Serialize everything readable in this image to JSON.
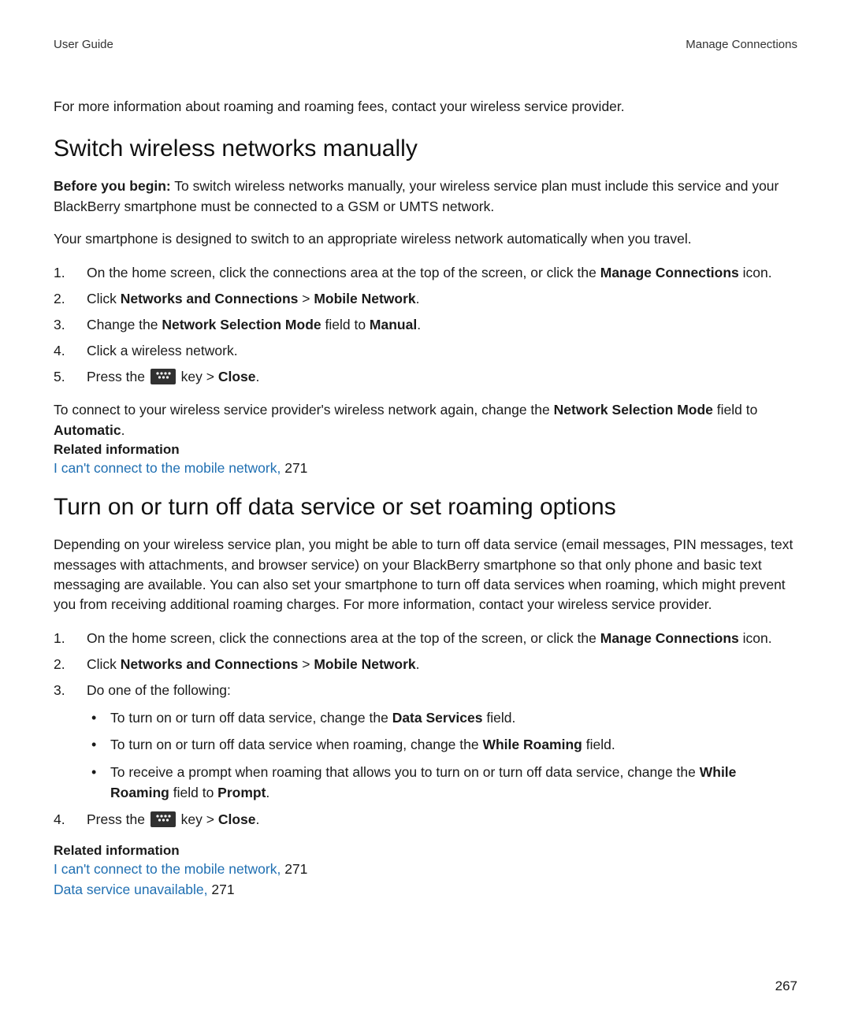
{
  "header": {
    "left": "User Guide",
    "right": "Manage Connections"
  },
  "intro": "For more information about roaming and roaming fees, contact your wireless service provider.",
  "section1": {
    "title": "Switch wireless networks manually",
    "before_label": "Before you begin:",
    "before_text": " To switch wireless networks manually, your wireless service plan must include this service and your BlackBerry smartphone must be connected to a GSM or UMTS network.",
    "para": "Your smartphone is designed to switch to an appropriate wireless network automatically when you travel.",
    "step1_a": "On the home screen, click the connections area at the top of the screen, or click the ",
    "step1_b": "Manage Connections",
    "step1_c": " icon.",
    "step2_a": "Click ",
    "step2_b": "Networks and Connections",
    "step2_c": " > ",
    "step2_d": "Mobile Network",
    "step2_e": ".",
    "step3_a": "Change the ",
    "step3_b": "Network Selection Mode",
    "step3_c": " field to ",
    "step3_d": "Manual",
    "step3_e": ".",
    "step4": "Click a wireless network.",
    "step5_a": "Press the ",
    "step5_b": " key > ",
    "step5_c": "Close",
    "step5_d": ".",
    "after_a": "To connect to your wireless service provider's wireless network again, change the ",
    "after_b": "Network Selection Mode",
    "after_c": " field to ",
    "after_d": "Automatic",
    "after_e": ".",
    "related_heading": "Related information",
    "link1_text": "I can't connect to the mobile network,",
    "link1_page": " 271"
  },
  "section2": {
    "title": "Turn on or turn off data service or set roaming options",
    "para": "Depending on your wireless service plan, you might be able to turn off data service (email messages, PIN messages, text messages with attachments, and browser service) on your BlackBerry smartphone so that only phone and basic text messaging are available. You can also set your smartphone to turn off data services when roaming, which might prevent you from receiving additional roaming charges. For more information, contact your wireless service provider.",
    "step1_a": "On the home screen, click the connections area at the top of the screen, or click the ",
    "step1_b": "Manage Connections",
    "step1_c": " icon.",
    "step2_a": "Click ",
    "step2_b": "Networks and Connections",
    "step2_c": " > ",
    "step2_d": "Mobile Network",
    "step2_e": ".",
    "step3": "Do one of the following:",
    "sub1_a": "To turn on or turn off data service, change the ",
    "sub1_b": "Data Services",
    "sub1_c": " field.",
    "sub2_a": "To turn on or turn off data service when roaming, change the ",
    "sub2_b": "While Roaming",
    "sub2_c": " field.",
    "sub3_a": "To receive a prompt when roaming that allows you to turn on or turn off data service, change the ",
    "sub3_b": "While Roaming",
    "sub3_c": " field to ",
    "sub3_d": "Prompt",
    "sub3_e": ".",
    "step4_a": "Press the ",
    "step4_b": " key > ",
    "step4_c": "Close",
    "step4_d": ".",
    "related_heading": "Related information",
    "link1_text": "I can't connect to the mobile network,",
    "link1_page": " 271",
    "link2_text": "Data service unavailable,",
    "link2_page": " 271"
  },
  "page_number": "267"
}
